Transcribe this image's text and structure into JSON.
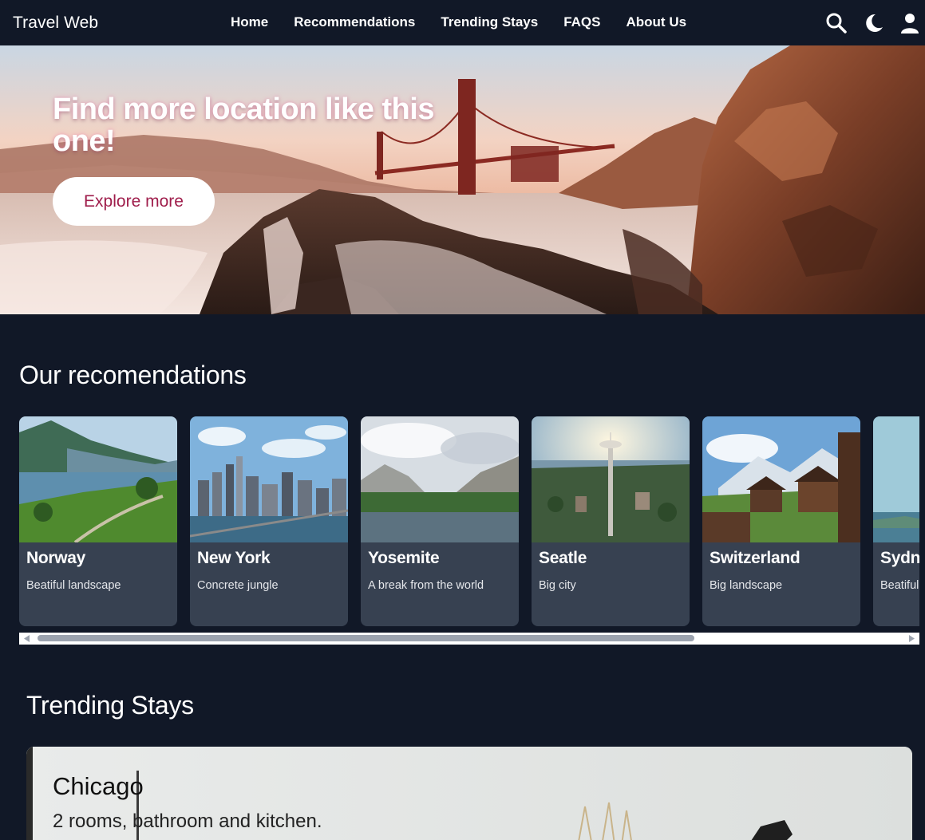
{
  "brand": "Travel Web",
  "nav": [
    {
      "label": "Home"
    },
    {
      "label": "Recommendations"
    },
    {
      "label": "Trending Stays"
    },
    {
      "label": "FAQS"
    },
    {
      "label": "About Us"
    }
  ],
  "nav_icons": [
    "search-icon",
    "moon-icon",
    "user-icon"
  ],
  "hero": {
    "title": "Find more location like this one!",
    "button_label": "Explore more"
  },
  "recommendations": {
    "title": "Our recomendations",
    "cards": [
      {
        "name": "Norway",
        "description": "Beatiful landscape"
      },
      {
        "name": "New York",
        "description": "Concrete jungle"
      },
      {
        "name": "Yosemite",
        "description": "A break from the world"
      },
      {
        "name": "Seatle",
        "description": "Big city"
      },
      {
        "name": "Switzerland",
        "description": "Big landscape"
      },
      {
        "name": "Sydney",
        "description": "Beatiful"
      }
    ]
  },
  "trending": {
    "title": "Trending Stays",
    "stays": [
      {
        "name": "Chicago",
        "description": "2 rooms, bathroom and kitchen."
      }
    ]
  },
  "colors": {
    "background": "#111827",
    "card": "#374151",
    "accent": "#9f1d4b",
    "scroll_thumb": "#9ca3af"
  }
}
